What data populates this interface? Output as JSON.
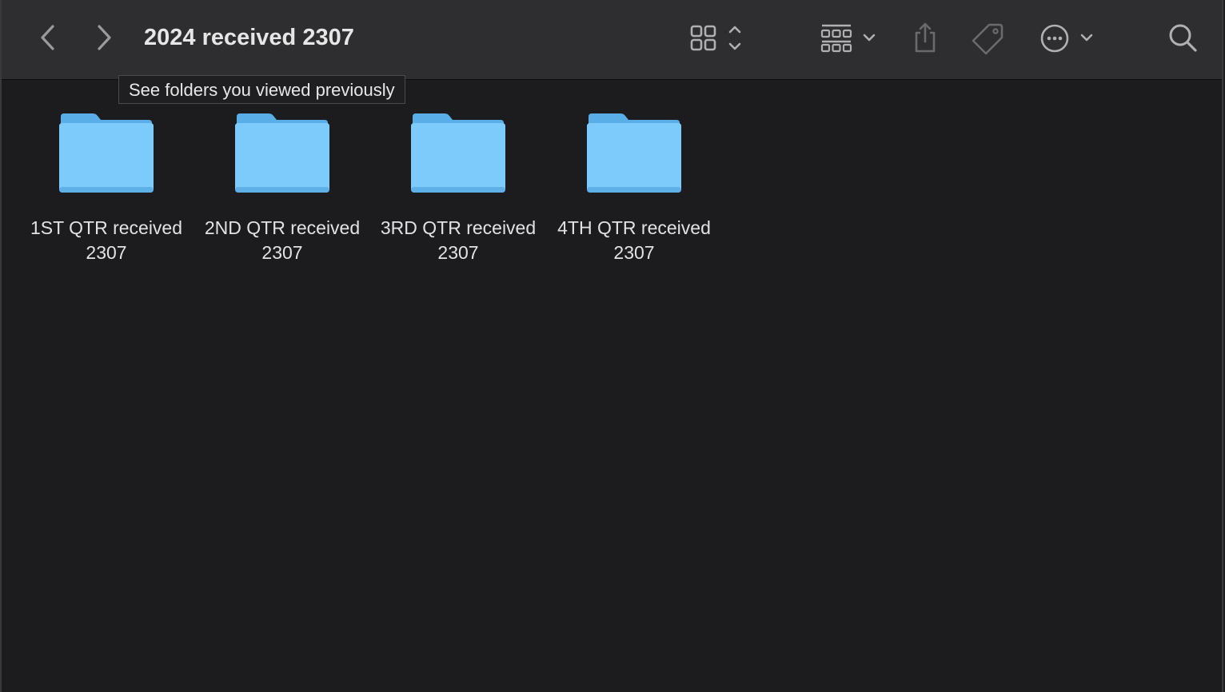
{
  "window": {
    "title": "2024 received 2307"
  },
  "toolbar": {
    "back_icon": "chevron-left-icon",
    "forward_icon": "chevron-right-icon",
    "view_icon": "grid-view-icon",
    "group_icon": "group-icon",
    "share_icon": "share-icon",
    "tag_icon": "tag-icon",
    "more_icon": "ellipsis-circle-icon",
    "search_icon": "search-icon"
  },
  "tooltip": {
    "text": "See folders you viewed previously"
  },
  "folders": [
    {
      "name": "1ST QTR received 2307"
    },
    {
      "name": "2ND QTR received 2307"
    },
    {
      "name": "3RD QTR received 2307"
    },
    {
      "name": "4TH QTR received 2307"
    }
  ],
  "colors": {
    "folder_front": "#7ccbfa",
    "folder_back": "#5aaee8",
    "toolbar_bg": "#2e2e30",
    "content_bg": "#1c1c1f"
  }
}
